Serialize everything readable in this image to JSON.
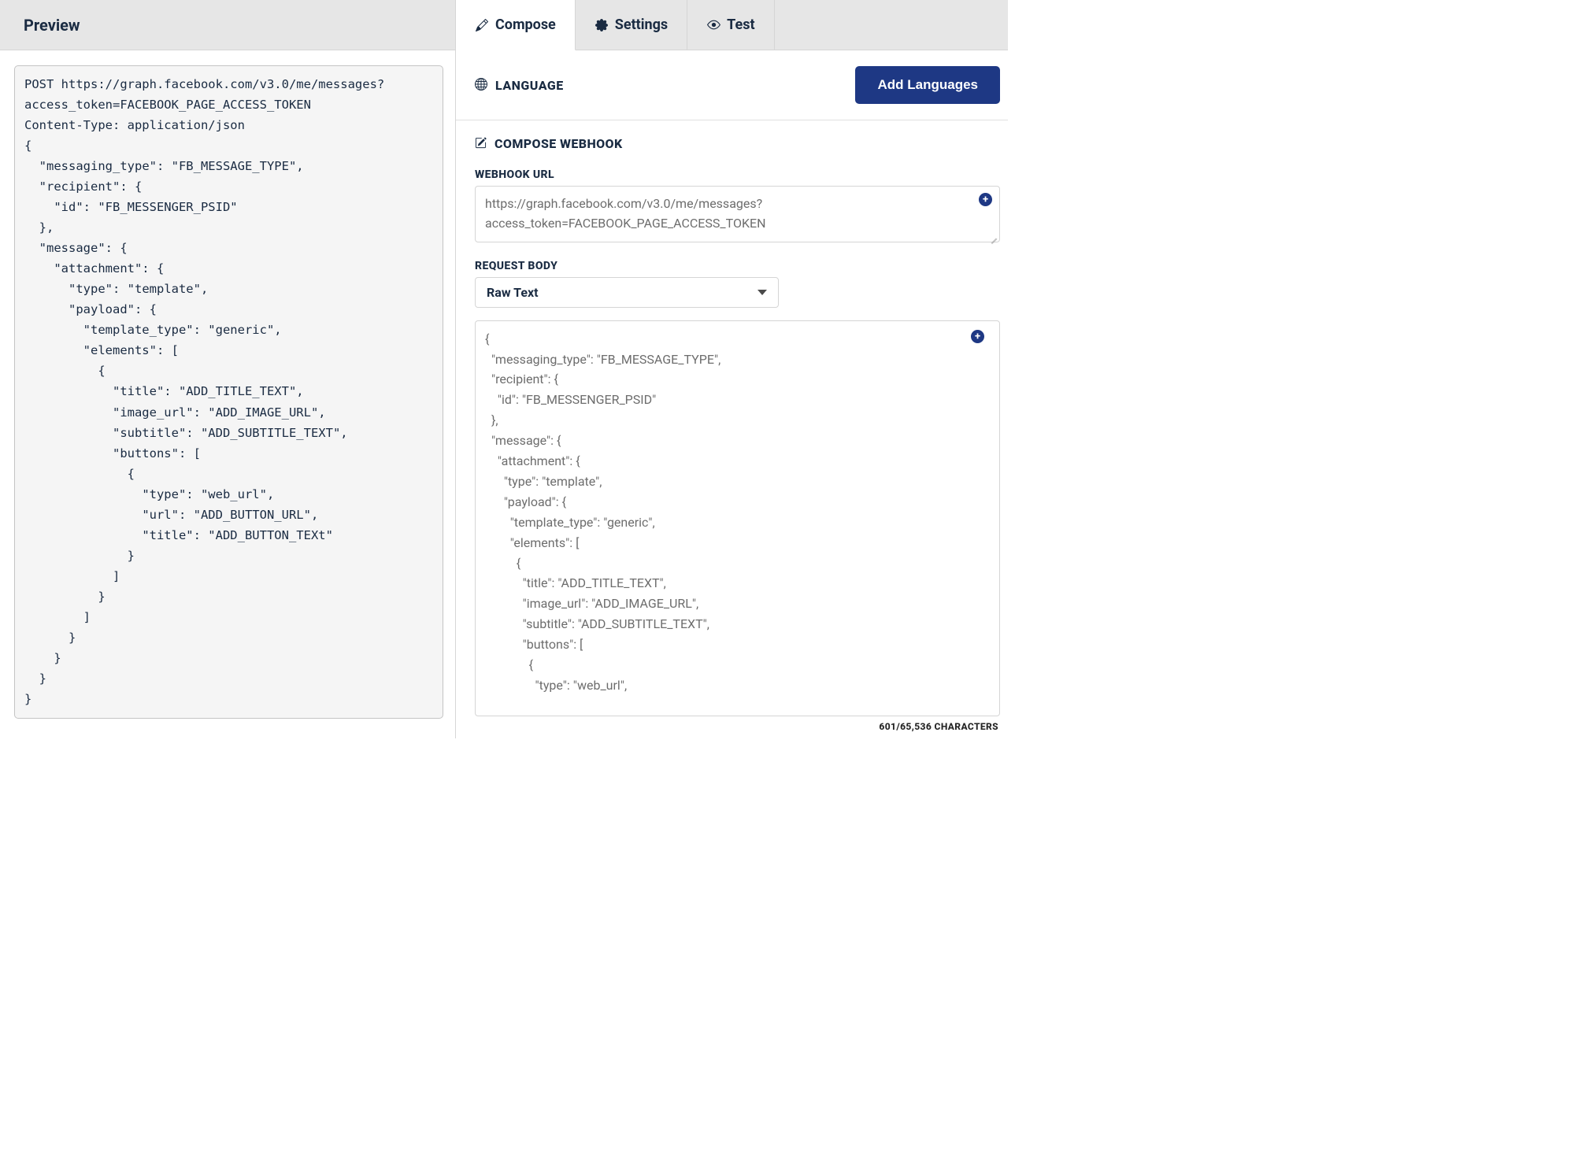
{
  "left": {
    "title": "Preview",
    "code": "POST https://graph.facebook.com/v3.0/me/messages?access_token=FACEBOOK_PAGE_ACCESS_TOKEN\nContent-Type: application/json\n{\n  \"messaging_type\": \"FB_MESSAGE_TYPE\",\n  \"recipient\": {\n    \"id\": \"FB_MESSENGER_PSID\"\n  },\n  \"message\": {\n    \"attachment\": {\n      \"type\": \"template\",\n      \"payload\": {\n        \"template_type\": \"generic\",\n        \"elements\": [\n          {\n            \"title\": \"ADD_TITLE_TEXT\",\n            \"image_url\": \"ADD_IMAGE_URL\",\n            \"subtitle\": \"ADD_SUBTITLE_TEXT\",\n            \"buttons\": [\n              {\n                \"type\": \"web_url\",\n                \"url\": \"ADD_BUTTON_URL\",\n                \"title\": \"ADD_BUTTON_TEXt\"\n              }\n            ]\n          }\n        ]\n      }\n    }\n  }\n}"
  },
  "tabs": {
    "compose": "Compose",
    "settings": "Settings",
    "test": "Test"
  },
  "language": {
    "label": "LANGUAGE",
    "button": "Add Languages"
  },
  "compose": {
    "section_title": "COMPOSE WEBHOOK",
    "url_label": "WEBHOOK URL",
    "url_value": "https://graph.facebook.com/v3.0/me/messages?access_token=FACEBOOK_PAGE_ACCESS_TOKEN",
    "body_label": "REQUEST BODY",
    "body_format": "Raw Text",
    "body_value": "{\n  \"messaging_type\": \"FB_MESSAGE_TYPE\",\n  \"recipient\": {\n    \"id\": \"FB_MESSENGER_PSID\"\n  },\n  \"message\": {\n    \"attachment\": {\n      \"type\": \"template\",\n      \"payload\": {\n        \"template_type\": \"generic\",\n        \"elements\": [\n          {\n            \"title\": \"ADD_TITLE_TEXT\",\n            \"image_url\": \"ADD_IMAGE_URL\",\n            \"subtitle\": \"ADD_SUBTITLE_TEXT\",\n            \"buttons\": [\n              {\n                \"type\": \"web_url\",",
    "char_count": "601/65,536 CHARACTERS"
  }
}
